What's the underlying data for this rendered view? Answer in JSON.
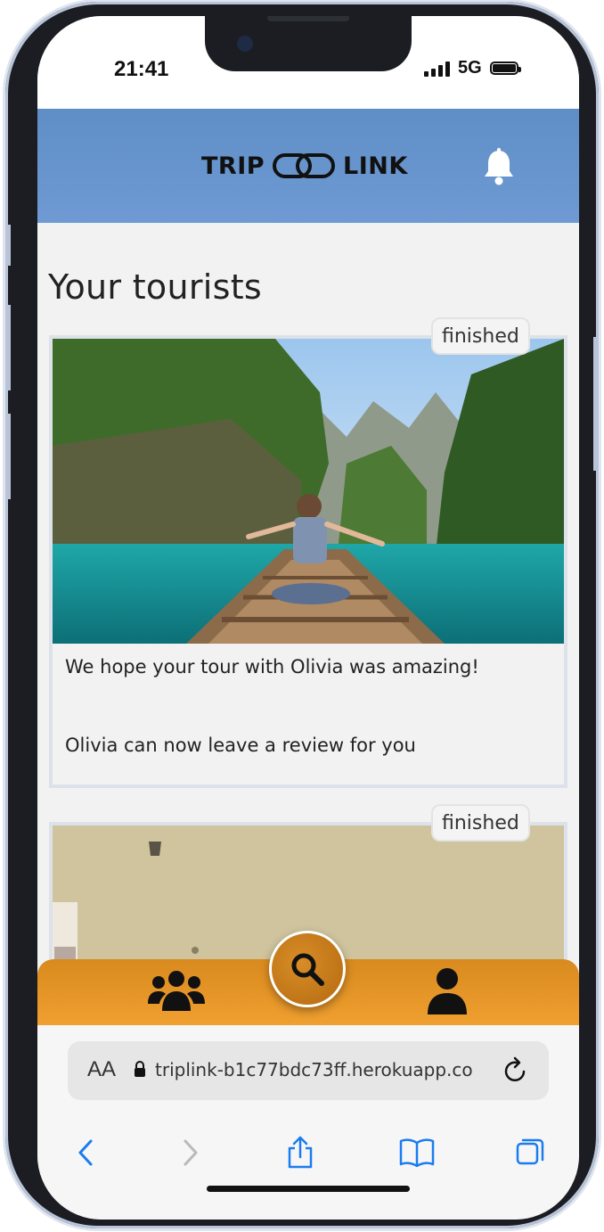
{
  "status_bar": {
    "time": "21:41",
    "network": "5G"
  },
  "header": {
    "logo_left": "TRIP",
    "logo_right": "LINK",
    "logo_icon": "chain-link-icon",
    "bell_icon": "bell-icon"
  },
  "main": {
    "title": "Your tourists",
    "cards": [
      {
        "status": "finished",
        "photo": "woman-on-boat-photo",
        "line1": "We hope your tour with Olivia was amazing!",
        "line2": "Olivia can now leave a review for you"
      },
      {
        "status": "finished",
        "photo": "concrete-wall-photo"
      }
    ]
  },
  "bottom_nav": {
    "left_icon": "users-group-icon",
    "center_icon": "search-icon",
    "right_icon": "user-icon"
  },
  "browser": {
    "aa_label": "AA",
    "url": "triplink-b1c77bdc73ff.herokuapp.co",
    "toolbar_icons": [
      "back-icon",
      "forward-icon",
      "share-icon",
      "bookmarks-icon",
      "tabs-icon"
    ]
  },
  "colors": {
    "header_blue": "#6f9ad3",
    "nav_orange": "#f0a030",
    "fab_brown": "#b46a10",
    "safari_blue": "#1a7cf0"
  }
}
